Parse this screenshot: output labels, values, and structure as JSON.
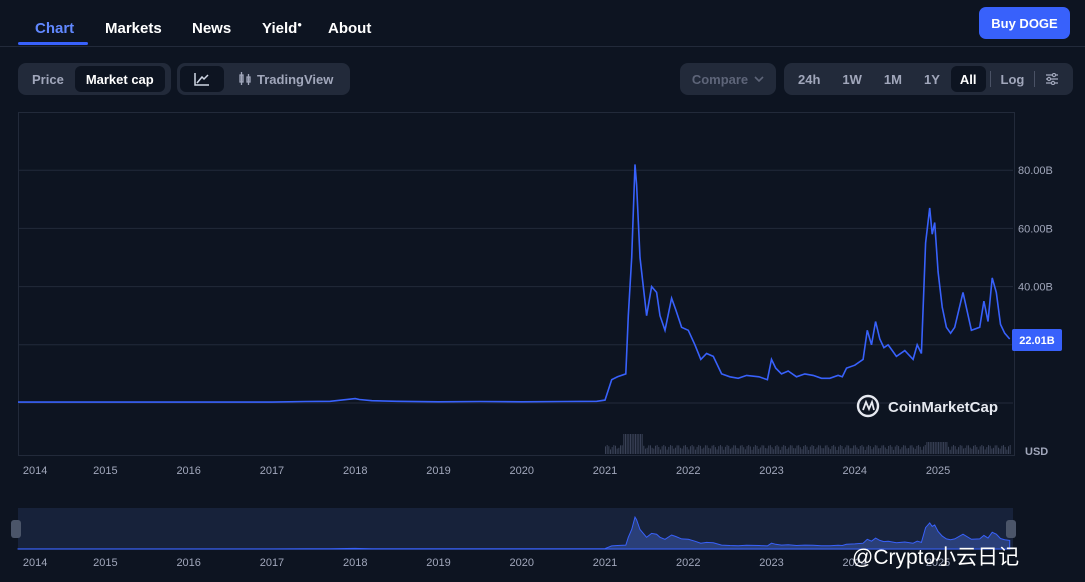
{
  "nav": {
    "tabs": [
      {
        "label": "Chart"
      },
      {
        "label": "Markets"
      },
      {
        "label": "News"
      },
      {
        "label": "Yield"
      },
      {
        "label": "About"
      }
    ],
    "buy_label": "Buy DOGE"
  },
  "toolbar": {
    "price_label": "Price",
    "market_cap_label": "Market cap",
    "tradingview_label": "TradingView",
    "compare_label": "Compare",
    "ranges": [
      "24h",
      "1W",
      "1M",
      "1Y",
      "All"
    ],
    "active_range": "All",
    "log_label": "Log"
  },
  "chart_data": {
    "type": "line",
    "x_ticks": [
      "2014",
      "2015",
      "2016",
      "2017",
      "2018",
      "2019",
      "2020",
      "2021",
      "2022",
      "2023",
      "2024",
      "2025"
    ],
    "y_ticks": [
      "80.00B",
      "60.00B",
      "40.00B"
    ],
    "ylim": [
      0,
      100
    ],
    "unit_label": "USD",
    "current_value_label": "22.01B",
    "current_value": 22.01,
    "line_color": "#3861fb",
    "grid": true,
    "x": [
      2013.95,
      2014.5,
      2015.0,
      2015.5,
      2016.0,
      2016.5,
      2017.0,
      2017.4,
      2017.7,
      2018.0,
      2018.05,
      2018.2,
      2018.5,
      2019.0,
      2019.5,
      2020.0,
      2020.5,
      2020.9,
      2021.0,
      2021.08,
      2021.15,
      2021.25,
      2021.28,
      2021.32,
      2021.36,
      2021.38,
      2021.42,
      2021.5,
      2021.56,
      2021.62,
      2021.66,
      2021.72,
      2021.8,
      2021.85,
      2021.92,
      2022.0,
      2022.08,
      2022.15,
      2022.22,
      2022.3,
      2022.4,
      2022.5,
      2022.6,
      2022.7,
      2022.85,
      2022.95,
      2023.0,
      2023.05,
      2023.12,
      2023.2,
      2023.3,
      2023.4,
      2023.5,
      2023.6,
      2023.7,
      2023.8,
      2023.85,
      2023.9,
      2024.0,
      2024.1,
      2024.15,
      2024.2,
      2024.25,
      2024.3,
      2024.35,
      2024.4,
      2024.5,
      2024.6,
      2024.7,
      2024.75,
      2024.8,
      2024.85,
      2024.9,
      2024.93,
      2024.96,
      2025.0,
      2025.05,
      2025.1,
      2025.15,
      2025.2,
      2025.3,
      2025.4,
      2025.5,
      2025.55,
      2025.6,
      2025.65,
      2025.7,
      2025.75,
      2025.8,
      2025.86
    ],
    "values": [
      0.3,
      0.3,
      0.3,
      0.3,
      0.3,
      0.3,
      0.3,
      0.5,
      0.6,
      1.5,
      1.2,
      0.8,
      0.6,
      0.4,
      0.5,
      0.4,
      0.5,
      0.6,
      1.0,
      8.0,
      9.0,
      10.0,
      30.0,
      50.0,
      82.0,
      75.0,
      50.0,
      30.0,
      40.0,
      38.0,
      30.0,
      25.0,
      36.0,
      32.0,
      26.0,
      25.0,
      20.0,
      15.0,
      17.0,
      16.0,
      10.0,
      9.0,
      8.5,
      9.5,
      9.0,
      8.0,
      15.0,
      12.0,
      10.0,
      11.0,
      9.0,
      10.0,
      9.5,
      8.5,
      8.5,
      9.5,
      9.0,
      12.0,
      13.0,
      15.0,
      25.0,
      20.0,
      28.0,
      22.0,
      19.0,
      20.0,
      16.0,
      18.0,
      15.0,
      20.0,
      17.0,
      55.0,
      67.0,
      58.0,
      62.0,
      45.0,
      33.0,
      26.0,
      24.0,
      26.0,
      38.0,
      25.0,
      26.0,
      35.0,
      28.0,
      43.0,
      38.0,
      27.0,
      24.0,
      22.01
    ]
  },
  "navigator": {
    "x_ticks": [
      "2014",
      "2015",
      "2016",
      "2017",
      "2018",
      "2019",
      "2020",
      "2021",
      "2022",
      "2023",
      "2024",
      "2025"
    ]
  },
  "brand_watermark": "CoinMarketCap",
  "corner_watermark": "@Crypto小云日记"
}
